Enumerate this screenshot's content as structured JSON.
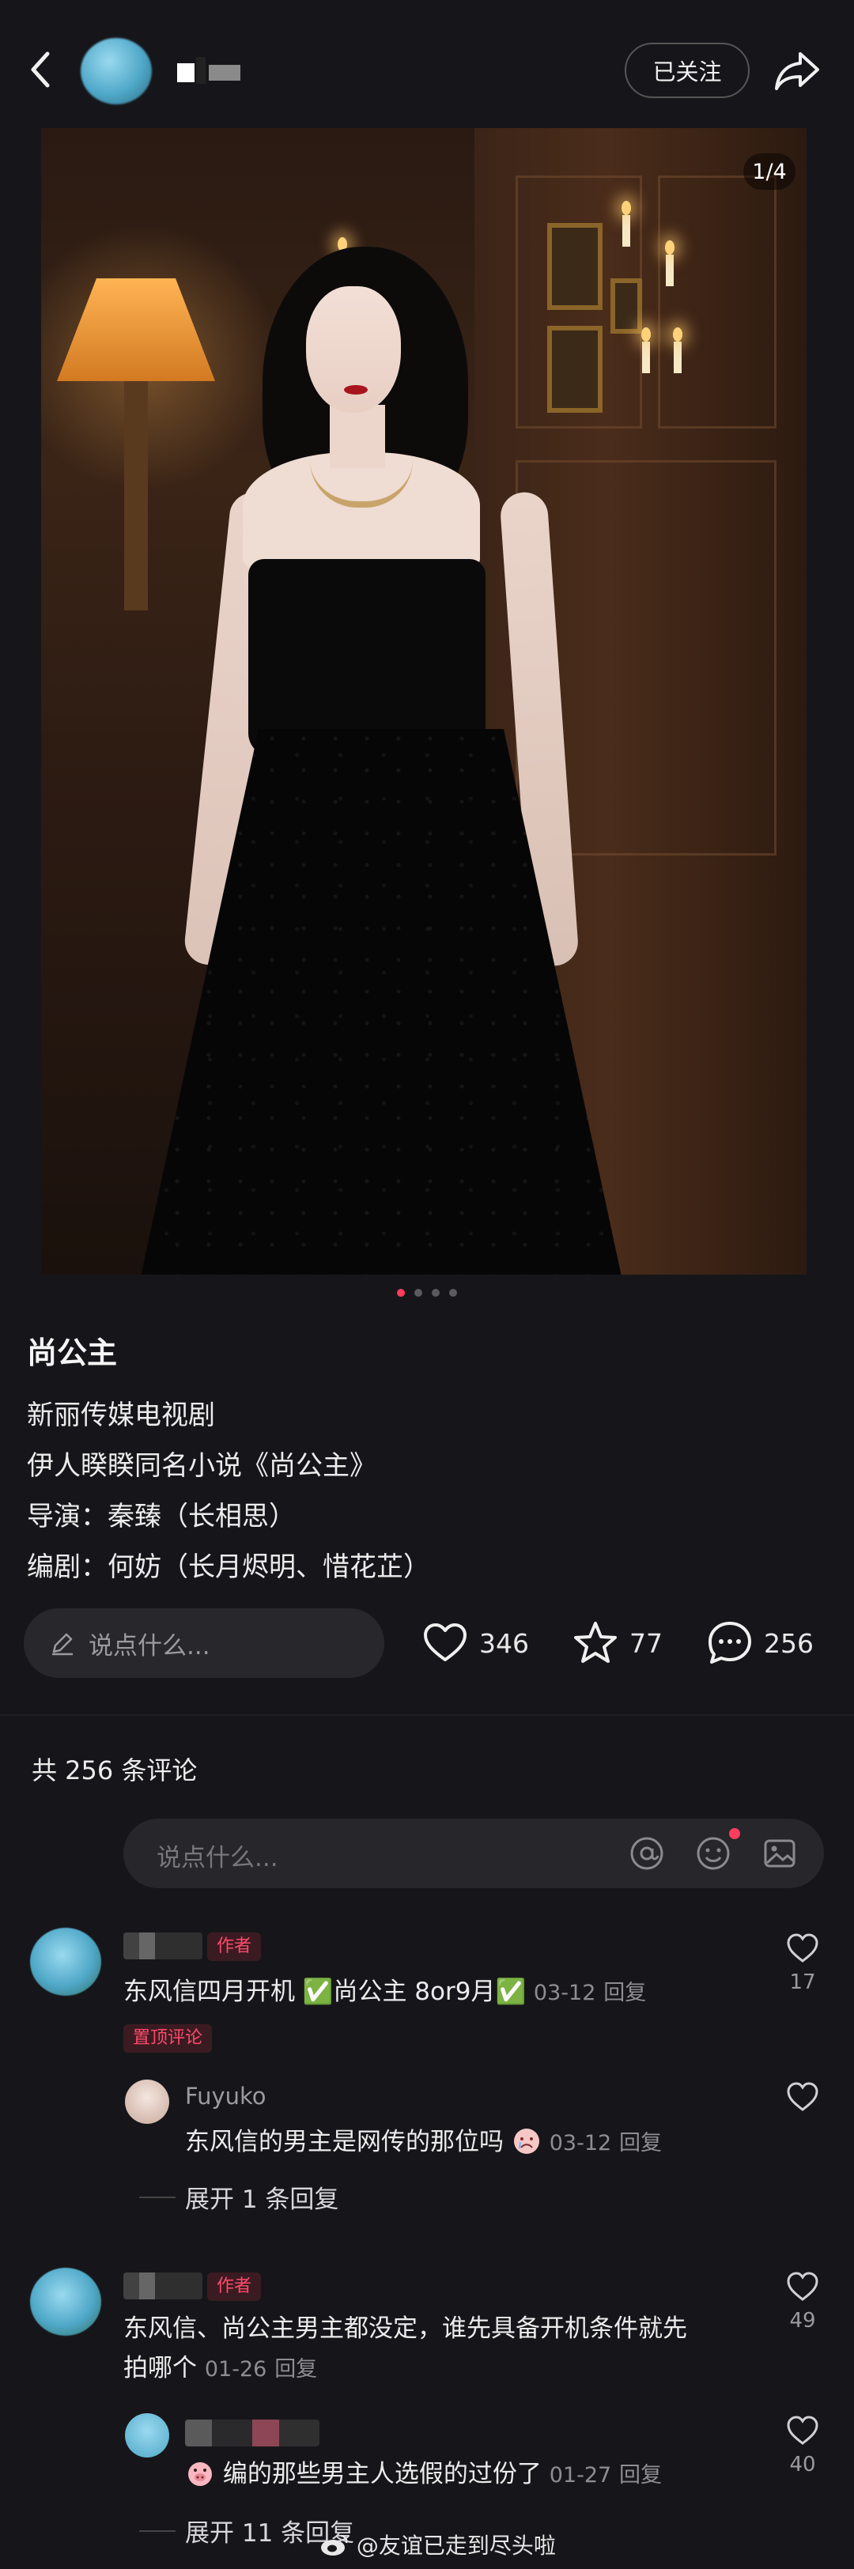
{
  "header": {
    "follow_label": "已关注"
  },
  "image": {
    "counter": "1/4",
    "page_count": 4,
    "active_index": 0
  },
  "post": {
    "title": "尚公主",
    "lines": [
      "新丽传媒电视剧",
      "伊人睽睽同名小说《尚公主》",
      "导演：秦臻（长相思）",
      "编剧：何妨（长月烬明、惜花芷）"
    ]
  },
  "actions": {
    "say_placeholder": "说点什么...",
    "likes": "346",
    "stars": "77",
    "comments": "256"
  },
  "comments_section": {
    "count_label": "共 256 条评论",
    "input_placeholder": "说点什么..."
  },
  "comments": [
    {
      "author_tag": "作者",
      "text": "东风信四月开机 ✅尚公主 8or9月✅",
      "date": "03-12",
      "reply_label": "回复",
      "pinned_tag": "置顶评论",
      "likes": "17",
      "reply": {
        "name": "Fuyuko",
        "text": "东风信的男主是网传的那位吗",
        "date": "03-12",
        "reply_label": "回复"
      },
      "expand": "展开 1 条回复"
    },
    {
      "author_tag": "作者",
      "text_line1": "东风信、尚公主男主都没定，谁先具备开机条件就先",
      "text_line2": "拍哪个",
      "date": "01-26",
      "reply_label": "回复",
      "likes": "49",
      "reply": {
        "text": "编的那些男主人选假的过份了",
        "date": "01-27",
        "reply_label": "回复",
        "likes": "40"
      },
      "expand": "展开 11 条回复"
    }
  ],
  "watermark": "@友谊已走到尽头啦",
  "colors": {
    "background": "#16161a",
    "accent_red": "#ff3d5d",
    "muted_text": "#9a9aa0"
  }
}
